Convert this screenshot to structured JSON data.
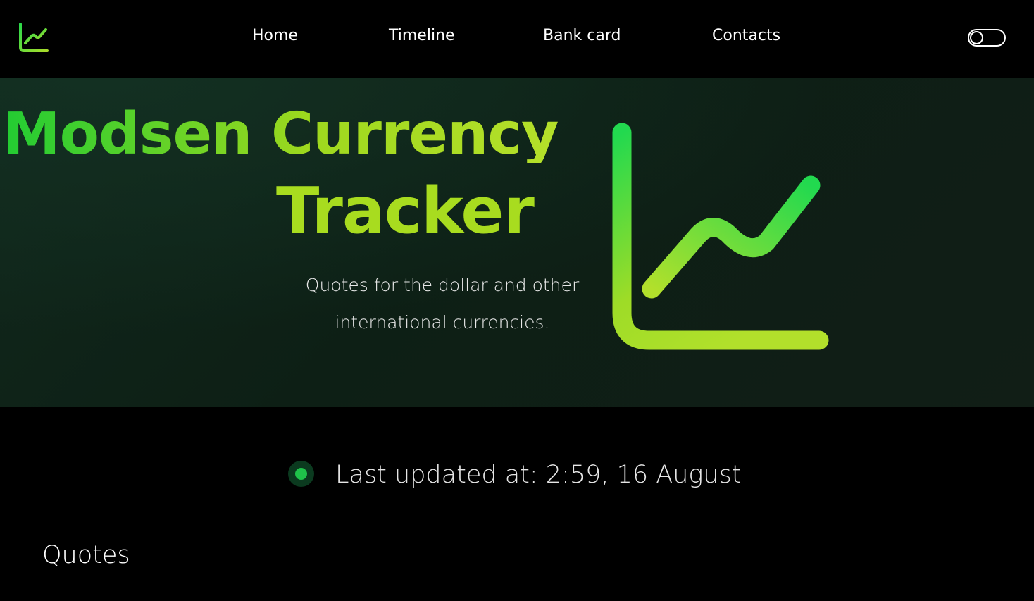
{
  "header": {
    "logo_icon": "line-chart-icon",
    "nav": {
      "home": "Home",
      "timeline": "Timeline",
      "bank_card": "Bank card",
      "contacts": "Contacts"
    },
    "theme_toggle_icon": "toggle-switch-icon"
  },
  "hero": {
    "title_line_1": "Modsen Currency",
    "title_line_2": "Tracker",
    "subtitle": "Quotes for the dollar and other international currencies.",
    "illustration_icon": "line-chart-icon"
  },
  "status": {
    "indicator_icon": "status-dot-icon",
    "text": "Last updated at: 2:59, 16 August"
  },
  "quotes": {
    "heading": "Quotes"
  },
  "colors": {
    "background": "#000000",
    "accent_green": "#22cc33",
    "accent_lime": "#a8dc1f",
    "status_green": "#1fc24a"
  }
}
